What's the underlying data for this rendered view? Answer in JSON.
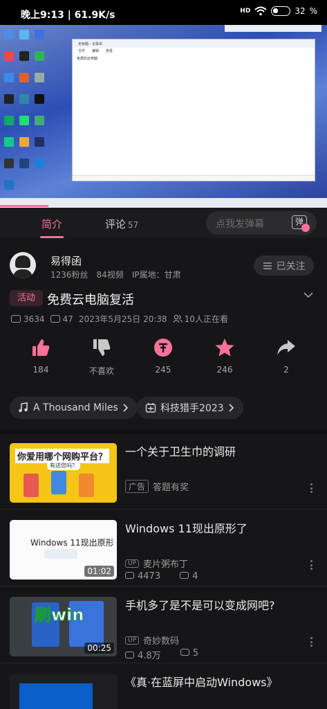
{
  "status_bar": {
    "time": "晚上9:13 | 61.9K/s",
    "signal": "HD",
    "battery": "32"
  },
  "video": {
    "notepad_tab": "无标题 - 记事本",
    "notepad_menu": [
      "文件",
      "编辑",
      "查看"
    ],
    "notepad_text": "免费的云电脑"
  },
  "tabs": {
    "intro": "简介",
    "comments": "评论",
    "comments_count": "57",
    "danmaku_placeholder": "点我发弹幕",
    "danmaku_icon_label": "弹"
  },
  "uploader": {
    "name": "易得函",
    "fans": "1236粉丝",
    "videos": "84视频",
    "ip": "IP属地：甘肃",
    "follow_label": "已关注"
  },
  "video_info": {
    "tag": "活动",
    "title": "免费云电脑复活",
    "plays": "3634",
    "danmaku": "47",
    "date": "2023年5月25日 20:38",
    "watching": "10人正在看"
  },
  "actions": {
    "like": "184",
    "dislike": "不喜欢",
    "coin": "245",
    "favorite": "246",
    "share": "2"
  },
  "chips": {
    "music": "A Thousand Miles",
    "event": "科技猎手2023"
  },
  "recommendations": [
    {
      "title": "一个关于卫生巾的调研",
      "badge": "广告",
      "author": "答题有奖",
      "thumb_text": "你爱用哪个网购平台？",
      "thumb_sub": "有送您吗？"
    },
    {
      "title": "Windows 11现出原形了",
      "author": "麦片粥布丁",
      "plays": "4473",
      "danmaku": "4",
      "duration": "01:02",
      "thumb_text": "Windows 11现出原形"
    },
    {
      "title": "手机多了是不是可以变成网吧?",
      "author": "奇妙数码",
      "plays": "4.8万",
      "danmaku": "5",
      "duration": "00:25",
      "thumb_text": "刷win"
    },
    {
      "title": "《真·在蓝屏中启动Windows》"
    }
  ],
  "colors": {
    "accent": "#fb7299",
    "background": "#161618"
  }
}
